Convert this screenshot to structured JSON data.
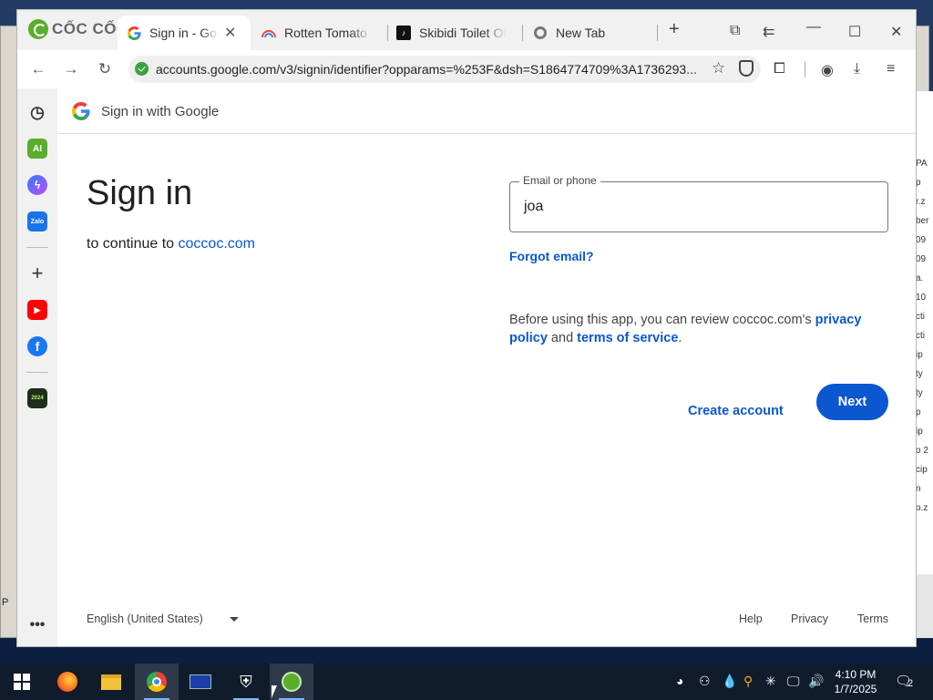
{
  "browser": {
    "brand": "CỐC CỐC",
    "tabs": [
      {
        "title": "Sign in - Google Accounts",
        "active": true
      },
      {
        "title": "Rotten Tomato De",
        "active": false
      },
      {
        "title": "Skibidi Toilet Offici",
        "active": false
      },
      {
        "title": "New Tab",
        "active": false
      }
    ],
    "url": "accounts.google.com/v3/signin/identifier?opparams=%253F&dsh=S1864774709%3A1736293..."
  },
  "page": {
    "header_title": "Sign in with Google",
    "heading": "Sign in",
    "continue_prefix": "to continue to ",
    "continue_site": "coccoc.com",
    "email_label": "Email or phone",
    "email_value": "joa",
    "forgot_email": "Forgot email?",
    "privacy_prefix": "Before using this app, you can review coccoc.com's ",
    "privacy_link": "privacy policy",
    "privacy_mid": " and ",
    "terms_link": "terms of service",
    "privacy_suffix": ".",
    "create_account": "Create account",
    "next": "Next",
    "language": "English (United States)",
    "footer": {
      "help": "Help",
      "privacy": "Privacy",
      "terms": "Terms"
    }
  },
  "sidebar": {
    "ai_label": "AI",
    "zalo_label": "Zalo",
    "badge_label": "2024"
  },
  "background_window": {
    "right_fragments": [
      "PA",
      "p",
      "r.z",
      "ber",
      "09",
      "09",
      "a.",
      "10",
      "cti",
      "cti",
      "ip",
      "ty",
      "ty",
      "p",
      "ip",
      "o 2",
      "cip",
      "n",
      "o.z"
    ],
    "left_fragment": "P"
  },
  "taskbar": {
    "time": "4:10 PM",
    "date": "1/7/2025",
    "notifications": "2"
  },
  "colors": {
    "accent": "#0b57d0",
    "coccoc_green": "#5aae2a"
  }
}
